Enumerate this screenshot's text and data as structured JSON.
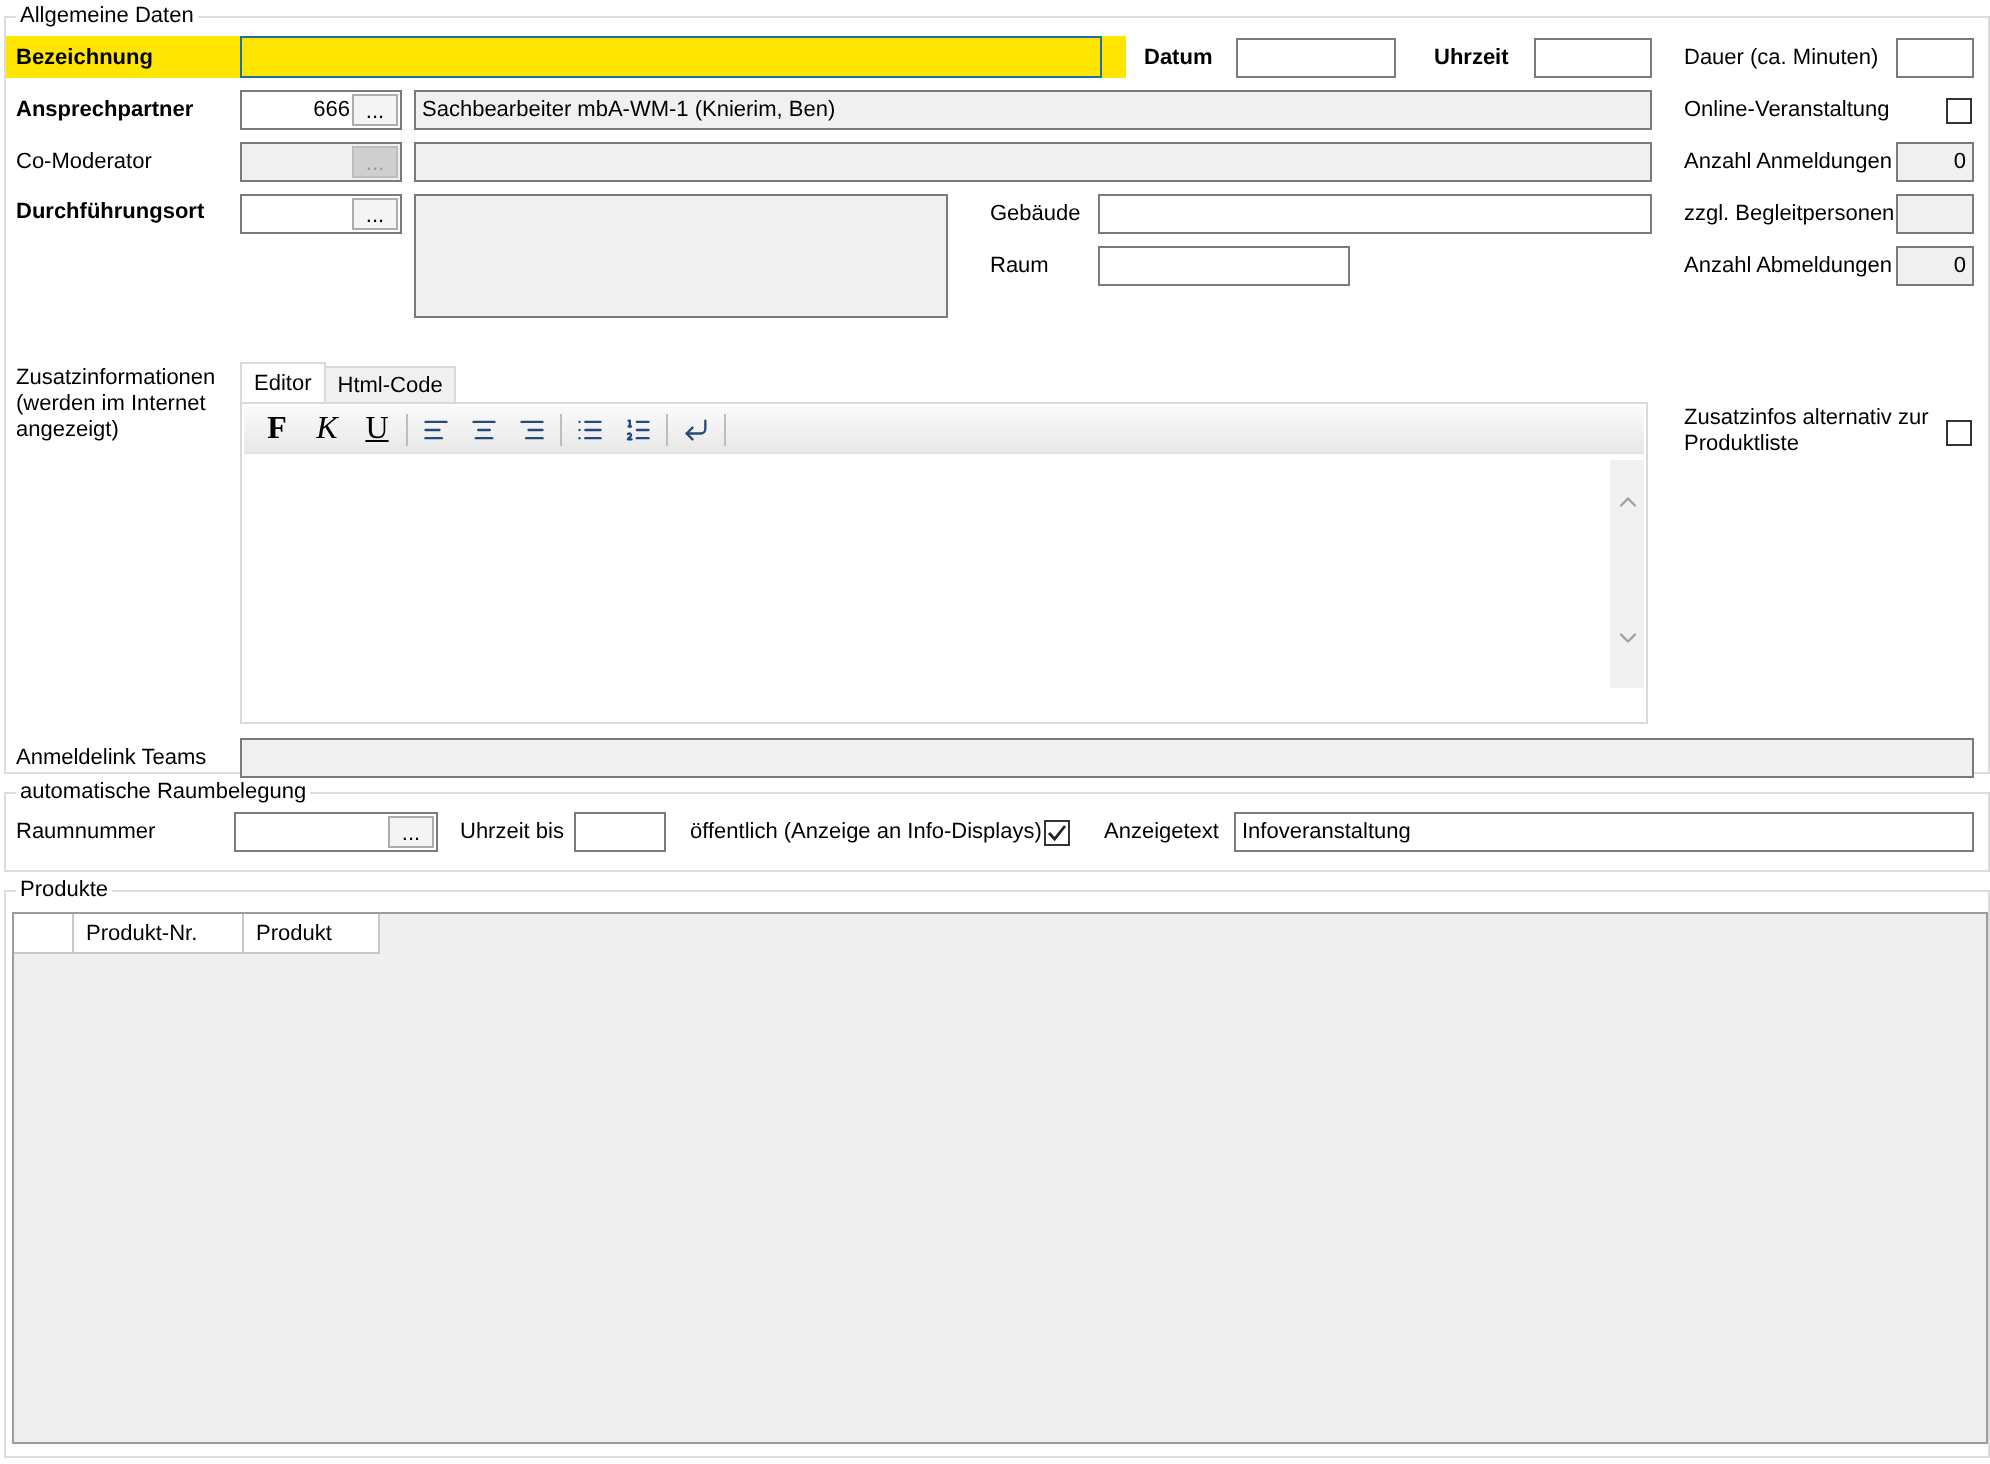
{
  "general": {
    "legend": "Allgemeine Daten",
    "bezeichnung": {
      "label": "Bezeichnung",
      "highlighted": true
    },
    "datum": {
      "label": "Datum"
    },
    "uhrzeit": {
      "label": "Uhrzeit"
    },
    "dauer": {
      "label": "Dauer (ca. Minuten)"
    },
    "ansprechpartner": {
      "label": "Ansprechpartner",
      "number": "666",
      "button": "...",
      "name": "Sachbearbeiter mbA-WM-1 (Knierim, Ben)"
    },
    "online": {
      "label": "Online-Veranstaltung",
      "checked": false
    },
    "co_moderator": {
      "label": "Co-Moderator",
      "button": "...",
      "disabled": true
    },
    "anmeldungen": {
      "label": "Anzahl Anmeldungen",
      "value": "0"
    },
    "durchfuehrungsort": {
      "label": "Durchführungsort",
      "button": "..."
    },
    "gebaeude": {
      "label": "Gebäude"
    },
    "begleitpersonen": {
      "label": "zzgl. Begleitpersonen"
    },
    "raum": {
      "label": "Raum"
    },
    "abmeldungen": {
      "label": "Anzahl Abmeldungen",
      "value": "0"
    },
    "zusatz": {
      "label": "Zusatzinformationen (werden im Internet angezeigt)",
      "tabs": [
        {
          "label": "Editor",
          "selected": true
        },
        {
          "label": "Html-Code",
          "selected": false
        }
      ],
      "format_buttons": [
        "F",
        "K",
        "U"
      ]
    },
    "zusatz_alternativ": {
      "label": "Zusatzinfos alternativ zur Produktliste",
      "checked": false
    },
    "teams": {
      "label": "Anmeldelink Teams"
    }
  },
  "room": {
    "legend": "automatische Raumbelegung",
    "raumnummer": {
      "label": "Raumnummer",
      "button": "..."
    },
    "uhrzeit_bis": {
      "label": "Uhrzeit bis"
    },
    "oeffentlich": {
      "label": "öffentlich (Anzeige an Info-Displays)",
      "checked": true
    },
    "anzeigetext": {
      "label": "Anzeigetext",
      "value": "Infoveranstaltung"
    }
  },
  "products": {
    "legend": "Produkte",
    "columns": [
      "Produkt-Nr.",
      "Produkt"
    ]
  }
}
